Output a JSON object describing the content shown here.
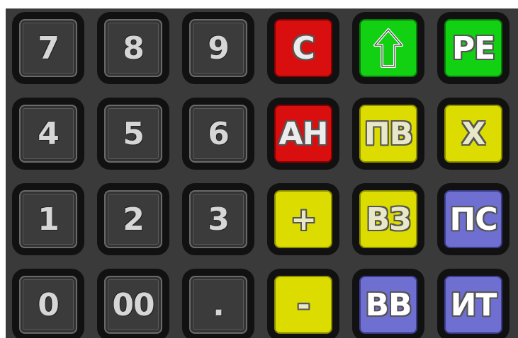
{
  "keys": {
    "k7": "7",
    "k8": "8",
    "k9": "9",
    "clear": "С",
    "up": "",
    "pe": "РЕ",
    "k4": "4",
    "k5": "5",
    "k6": "6",
    "an": "АН",
    "pv": "ПВ",
    "x": "Х",
    "k1": "1",
    "k2": "2",
    "k3": "3",
    "plus": "+",
    "vz": "ВЗ",
    "ps": "ПС",
    "k0": "0",
    "k00": "00",
    "dot": ".",
    "minus": "-",
    "vv": "ВВ",
    "it": "ИТ"
  },
  "icons": {
    "up": "up-arrow-icon"
  },
  "colors": {
    "dark": "#3b3b3b",
    "red": "#d90f0f",
    "green": "#12d012",
    "yellow": "#dcdc00",
    "blue": "#6f6fd2",
    "background": "#3a3a3a"
  }
}
